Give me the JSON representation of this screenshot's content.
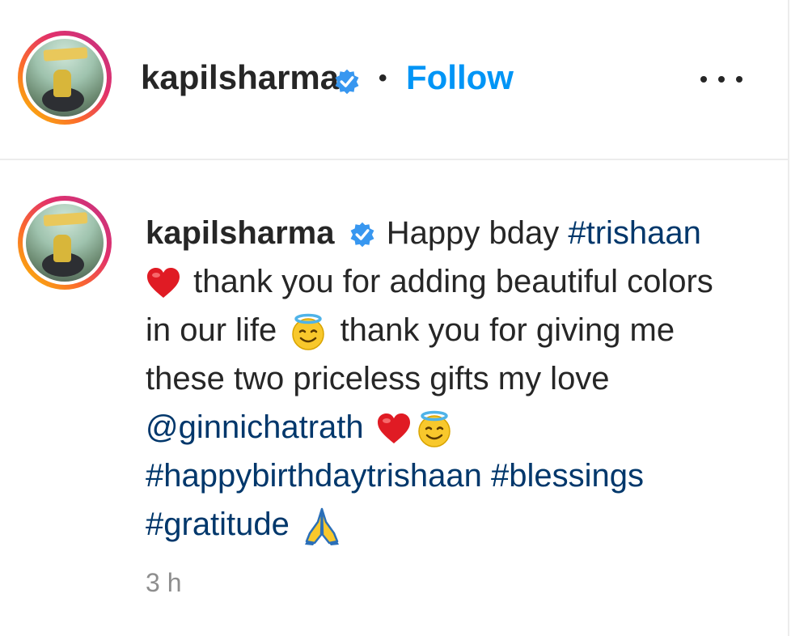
{
  "header": {
    "username": "kapilsharma",
    "separator": "•",
    "follow_label": "Follow"
  },
  "comment": {
    "username": "kapilsharma",
    "segments": {
      "s1": "Happy bday",
      "tag1": "#trishaan",
      "s2": "thank you for adding beautiful colors in our life",
      "s3": "thank you for giving me these two priceless gifts my love",
      "mention": "@ginnichatrath",
      "tag2": "#happybirthdaytrishaan",
      "tag3": "#blessings",
      "tag4": "#gratitude"
    },
    "time": "3 h"
  },
  "icons": {
    "verified": "verified-badge-icon",
    "more": "more-options-icon",
    "heart": "red-heart-emoji",
    "halo": "smiling-face-with-halo-emoji",
    "pray": "folded-hands-emoji"
  },
  "colors": {
    "follow": "#0095f6",
    "hashtag": "#00376b",
    "verified": "#3897f0",
    "muted": "#8e8e8e"
  }
}
